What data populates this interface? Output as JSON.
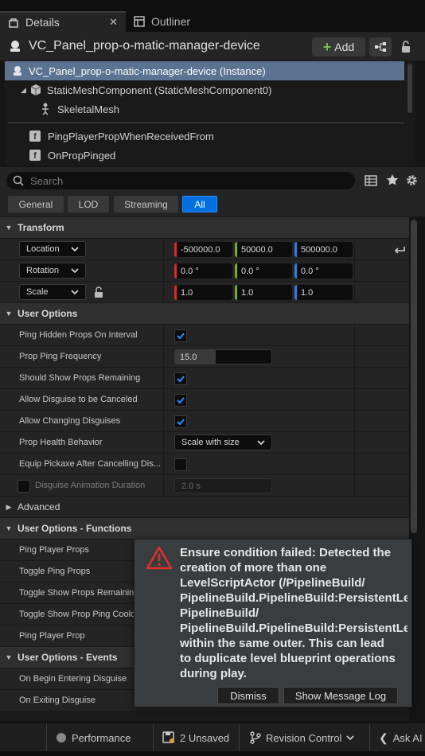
{
  "tabs": {
    "details": "Details",
    "close": "✕",
    "outliner": "Outliner"
  },
  "header": {
    "title": "VC_Panel_prop-o-matic-manager-device",
    "add_label": "Add"
  },
  "tree": {
    "items": [
      {
        "label": "VC_Panel_prop-o-matic-manager-device (Instance)",
        "selected": true
      },
      {
        "label": "StaticMeshComponent (StaticMeshComponent0)"
      },
      {
        "label": "SkeletalMesh"
      },
      {
        "label": "PingPlayerPropWhenReceivedFrom"
      },
      {
        "label": "OnPropPinged"
      }
    ]
  },
  "search": {
    "placeholder": "Search"
  },
  "filters": [
    "General",
    "LOD",
    "Streaming",
    "All"
  ],
  "transform": {
    "title": "Transform",
    "location": {
      "label": "Location",
      "x": "-500000.0",
      "y": "50000.0",
      "z": "500000.0"
    },
    "rotation": {
      "label": "Rotation",
      "x": "0.0 °",
      "y": "0.0 °",
      "z": "0.0 °"
    },
    "scale": {
      "label": "Scale",
      "x": "1.0",
      "y": "1.0",
      "z": "1.0"
    }
  },
  "user_options": {
    "title": "User Options",
    "ping_hidden": "Ping Hidden Props On Interval",
    "ping_freq": "Prop Ping Frequency",
    "ping_freq_value": "15.0",
    "ping_freq_fill": 0.42,
    "show_remaining": "Should Show Props Remaining",
    "allow_cancel": "Allow Disguise to be Canceled",
    "allow_change": "Allow Changing Disguises",
    "health": "Prop Health Behavior",
    "health_value": "Scale with size",
    "equip": "Equip Pickaxe After Cancelling Dis...",
    "anim_duration": "Disguise Animation Duration",
    "anim_duration_value": "2.0 s"
  },
  "advanced": "Advanced",
  "functions": {
    "title": "User Options - Functions",
    "items": [
      "Ping Player Props",
      "Toggle Ping Props",
      "Toggle Show Props Remaining",
      "Toggle Show Prop Ping Cooldown",
      "Ping Player Prop"
    ]
  },
  "events": {
    "title": "User Options - Events",
    "items": [
      "On Begin Entering Disguise",
      "On Exiting Disguise"
    ]
  },
  "dialog": {
    "lines": [
      "Ensure condition failed: Detected the",
      "creation of more than one",
      "LevelScriptActor (/PipelineBuild/",
      "PipelineBuild.PipelineBuild:PersistentLevel.",
      "PipelineBuild/",
      "PipelineBuild.PipelineBuild:PersistentLevel.",
      "within the same outer. This can lead",
      "to duplicate level blueprint operations",
      "during play."
    ],
    "dismiss": "Dismiss",
    "show_log": "Show Message Log"
  },
  "status": {
    "performance": "Performance",
    "unsaved": "2 Unsaved",
    "revision": "Revision Control",
    "ask": "Ask AI"
  },
  "colors": {
    "x_axis": "#d0302f",
    "y_axis": "#7aae20",
    "z_axis": "#2f7fd8",
    "accent": "#0070e0",
    "selection": "#5b7290",
    "warning": "#e0302a"
  }
}
